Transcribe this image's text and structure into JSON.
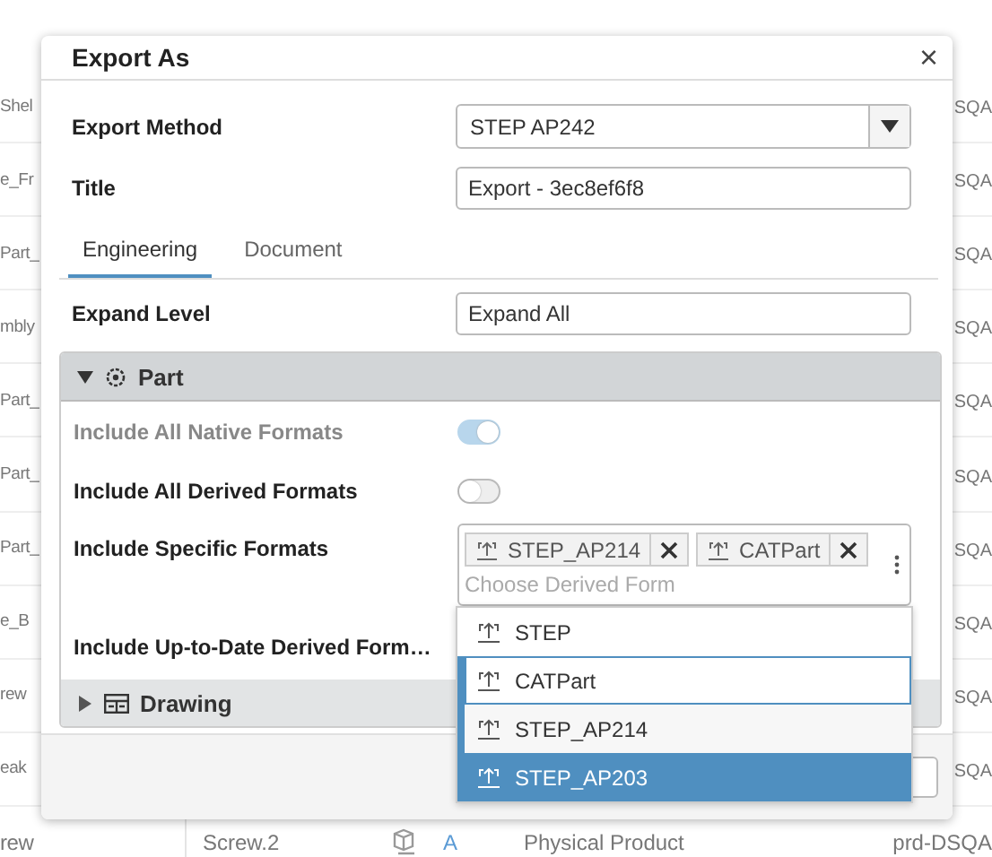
{
  "background": {
    "rows": [
      {
        "column_1": "Shel",
        "column_6": "SQA"
      },
      {
        "column_1": "e_Fr",
        "column_6": "SQA"
      },
      {
        "column_1": "Part_",
        "column_6": "SQA"
      },
      {
        "column_1": "mbly",
        "column_6": "SQA"
      },
      {
        "column_1": "Part_",
        "column_6": "SQA"
      },
      {
        "column_1": "Part_",
        "column_6": "SQA"
      },
      {
        "column_1": "Part_",
        "column_6": "SQA"
      },
      {
        "column_1": "e_B",
        "column_6": "SQA"
      },
      {
        "column_1": "rew",
        "column_6": "SQA"
      },
      {
        "column_1": "eak",
        "column_6": "SQA"
      },
      {
        "column_1": "rew",
        "column_2": "Screw.2",
        "column_4": "A",
        "column_5": "Physical Product",
        "column_6": "prd-DSQA"
      }
    ]
  },
  "dialog": {
    "title": "Export As",
    "close": "×",
    "fields": [
      {
        "label": "Export Method",
        "kind": "select",
        "value": "STEP AP242"
      },
      {
        "label": "Title",
        "kind": "input",
        "value": "Export - 3ec8ef6f8"
      }
    ],
    "tabs": [
      {
        "label": "Engineering",
        "selected": true
      },
      {
        "label": "Document",
        "selected": false
      }
    ],
    "expand_level": {
      "label": "Expand Level",
      "value": "Expand All"
    },
    "sections": [
      {
        "title": "Part",
        "expanded": true,
        "rows": [
          {
            "kind": "toggle",
            "label": "Include All Native Formats",
            "on": true,
            "disabled": true
          },
          {
            "kind": "toggle",
            "label": "Include All Derived Formats",
            "on": false,
            "disabled": false
          },
          {
            "kind": "multiselect",
            "label": "Include Specific Formats",
            "chips": [
              "STEP_AP214",
              "CATPart"
            ],
            "placeholder": "Choose Derived Form"
          },
          {
            "kind": "toggle_hidden",
            "label": "Include Up-to-Date Derived Form…"
          }
        ]
      },
      {
        "title": "Drawing",
        "expanded": false
      }
    ],
    "dropdown": [
      {
        "label": "STEP",
        "chosen": false,
        "focused": false,
        "selected": false
      },
      {
        "label": "CATPart",
        "chosen": true,
        "focused": true,
        "selected": false
      },
      {
        "label": "STEP_AP214",
        "chosen": true,
        "focused": false,
        "selected": false
      },
      {
        "label": "STEP_AP203",
        "chosen": false,
        "focused": false,
        "selected": true
      }
    ]
  }
}
